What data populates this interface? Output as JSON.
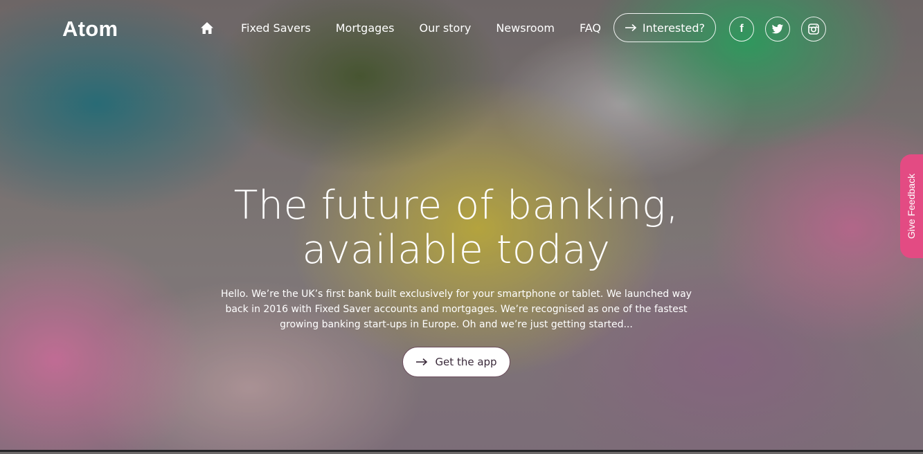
{
  "header": {
    "logo_text": "Atom",
    "nav": {
      "home_icon": "home-icon",
      "items": [
        {
          "label": "Fixed Savers"
        },
        {
          "label": "Mortgages"
        },
        {
          "label": "Our story"
        },
        {
          "label": "Newsroom"
        },
        {
          "label": "FAQ"
        }
      ],
      "interested_label": "Interested?",
      "interested_icon": "arrow-right-icon"
    },
    "social": [
      {
        "icon": "facebook-icon",
        "glyph": "f"
      },
      {
        "icon": "twitter-icon"
      },
      {
        "icon": "instagram-icon"
      }
    ]
  },
  "hero": {
    "headline_line1": "The future of banking,",
    "headline_line2": "available today",
    "intro_line1": "Hello. We’re the UK’s first bank built exclusively for your smartphone or tablet. We launched way",
    "intro_line2": "back in 2016 with Fixed Saver accounts and mortgages. We’re recognised as one of the fastest",
    "intro_line3": "growing banking start-ups in Europe. Oh and we’re just getting started...",
    "cta_label": "Get the app",
    "cta_icon": "arrow-right-icon"
  },
  "feedback": {
    "label": "Give Feedback"
  },
  "colors": {
    "feedback_tab": "#e34b83",
    "text": "#ffffff",
    "cta_text": "#3a2a3a"
  }
}
